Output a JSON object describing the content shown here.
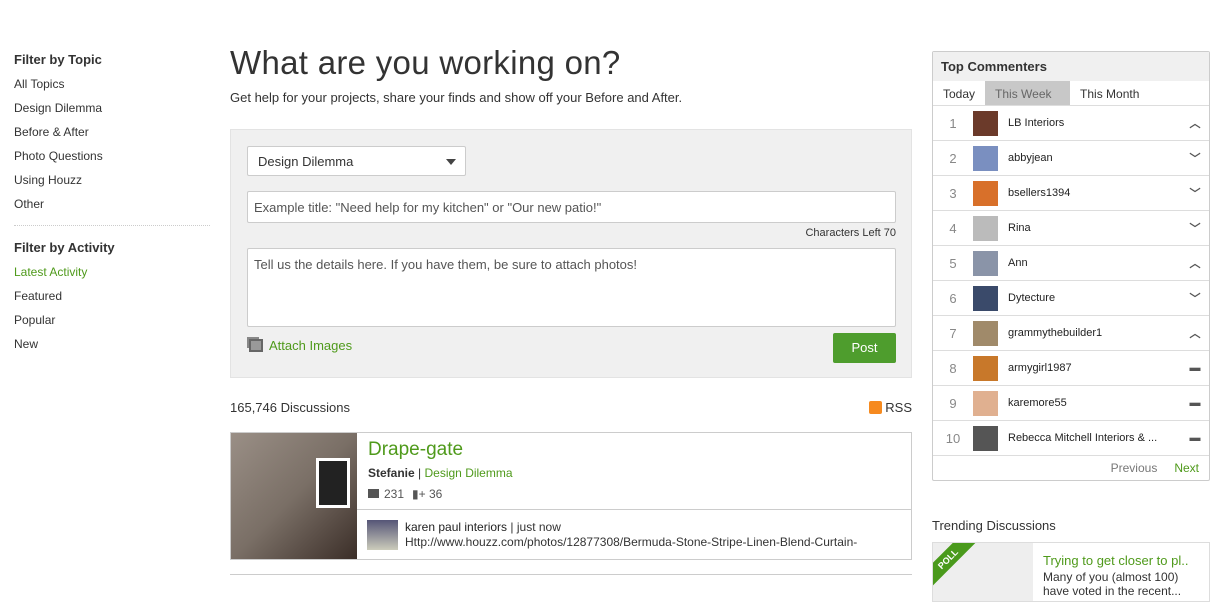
{
  "left": {
    "topic_heading": "Filter by Topic",
    "topics": [
      "All Topics",
      "Design Dilemma",
      "Before & After",
      "Photo Questions",
      "Using Houzz",
      "Other"
    ],
    "activity_heading": "Filter by Activity",
    "activities": [
      "Latest Activity",
      "Featured",
      "Popular",
      "New"
    ]
  },
  "main": {
    "title": "What are you working on?",
    "subtitle": "Get help for your projects, share your finds and show off your Before and After.",
    "form": {
      "topic_select": "Design Dilemma",
      "title_placeholder": "Example title: \"Need help for my kitchen\" or \"Our new patio!\"",
      "chars_left_label": "Characters Left",
      "chars_left": "70",
      "details_placeholder": "Tell us the details here. If you have them, be sure to attach photos!",
      "attach_label": "Attach Images",
      "post_label": "Post"
    },
    "discussions_count": "165,746 Discussions",
    "rss_label": "RSS",
    "discussion": {
      "title": "Drape-gate",
      "author": "Stefanie",
      "sep": "|",
      "topic": "Design Dilemma",
      "comments": "231",
      "follows": "36",
      "last_author": "karen paul interiors",
      "last_time": "| just now",
      "last_text": "Http://www.houzz.com/photos/12877308/Bermuda-Stone-Stripe-Linen-Blend-Curtain-"
    }
  },
  "right": {
    "top_title": "Top Commenters",
    "tabs": [
      "Today",
      "This Week",
      "This Month"
    ],
    "commenters": [
      {
        "rank": "1",
        "name": "LB Interiors",
        "trend": "up",
        "color": "#6b3a2a"
      },
      {
        "rank": "2",
        "name": "abbyjean",
        "trend": "down",
        "color": "#7a8fc0"
      },
      {
        "rank": "3",
        "name": "bsellers1394",
        "trend": "down",
        "color": "#d8702a"
      },
      {
        "rank": "4",
        "name": "Rina",
        "trend": "down",
        "color": "#bbbbbb"
      },
      {
        "rank": "5",
        "name": "Ann",
        "trend": "up",
        "color": "#8a94a8"
      },
      {
        "rank": "6",
        "name": "Dytecture",
        "trend": "down",
        "color": "#3a4a6a"
      },
      {
        "rank": "7",
        "name": "grammythebuilder1",
        "trend": "up",
        "color": "#a08a6a"
      },
      {
        "rank": "8",
        "name": "armygirl1987",
        "trend": "same",
        "color": "#c8782a"
      },
      {
        "rank": "9",
        "name": "karemore55",
        "trend": "same",
        "color": "#e0b090"
      },
      {
        "rank": "10",
        "name": "Rebecca Mitchell Interiors & ...",
        "trend": "same",
        "color": "#555555"
      }
    ],
    "prev": "Previous",
    "next": "Next",
    "trending_title": "Trending Discussions",
    "poll_label": "POLL",
    "trend_item_title": "Trying to get closer to pl..",
    "trend_item_text": "Many of you (almost 100) have voted in the recent..."
  }
}
